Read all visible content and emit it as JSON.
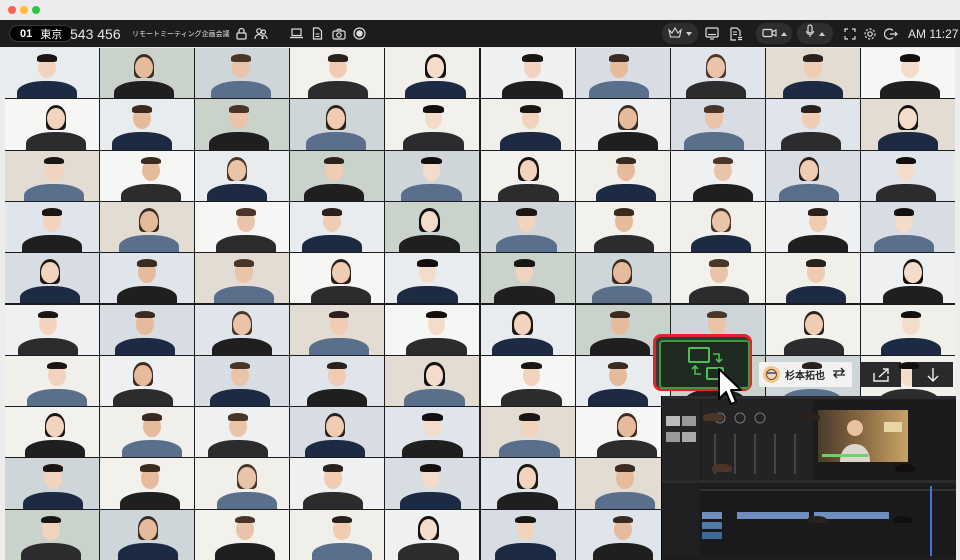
{
  "window": {
    "traffic_lights": [
      {
        "name": "close",
        "color": "#ff5f57"
      },
      {
        "name": "minimize",
        "color": "#febc2e"
      },
      {
        "name": "zoom",
        "color": "#28c840"
      }
    ]
  },
  "toolbar": {
    "room_number": "01",
    "room_location": "東京",
    "meeting_id": "543 456",
    "meeting_title": "リモートミーティング企画会議",
    "clock": "AM 11:27"
  },
  "icons": {
    "left": [
      "lock-icon",
      "people-icon",
      "laptop-icon",
      "document-icon",
      "camera-icon",
      "record-icon"
    ],
    "right": [
      "crown-icon",
      "monitor-icon",
      "file-list-icon",
      "video-camera-icon",
      "microphone-icon",
      "fullscreen-icon",
      "settings-icon",
      "exit-icon"
    ]
  },
  "participants": {
    "count": 100,
    "active_speaker": "杉本拓也",
    "palette": {
      "backgrounds": [
        "#e9ecef",
        "#f3f1ec",
        "#d8dde3",
        "#f6f6f4",
        "#cfd6da",
        "#eef0f2",
        "#e3dcd2",
        "#c9d3cc",
        "#f1efea",
        "#dfe5ea"
      ],
      "skins": [
        "#f2d3bd",
        "#eac4a8",
        "#f4dccb",
        "#e6bb9c",
        "#f0cdb2"
      ],
      "hairs": [
        "#1a1613",
        "#2b211c",
        "#3a2a20",
        "#120f0e",
        "#4a3628"
      ],
      "clothes": [
        "#1d2a44",
        "#ffffff",
        "#2c2c2e",
        "#e8e2d6",
        "#5a6f8c",
        "#9aa8b6",
        "#1f1f1f",
        "#d9d4ca"
      ]
    }
  },
  "controls": {
    "switch_view": {
      "icon": "switch-screen-icon",
      "border_color": "#e2242b",
      "accent": "#3d9a3d"
    },
    "swap_icon": "swap-arrows-icon",
    "share_icon": "share-out-icon",
    "download_icon": "download-icon"
  },
  "shared_screen": {
    "app": "video-editor",
    "preview_caption_color": "#6bd16b"
  }
}
